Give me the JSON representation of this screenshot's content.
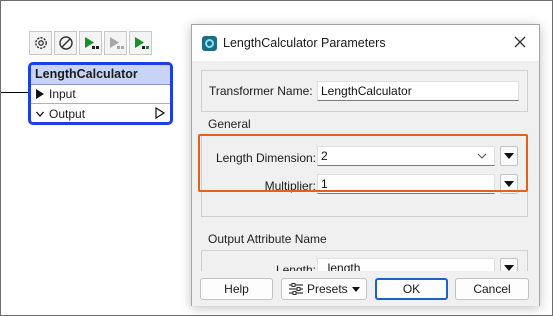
{
  "canvas": {
    "toolbar": {
      "icons": [
        "gear-icon",
        "disable-icon",
        "run-to-this-icon",
        "run-from-this-icon",
        "run-only-this-icon"
      ]
    },
    "node": {
      "title": "LengthCalculator",
      "input_port": "Input",
      "output_port": "Output",
      "selected_color": "#1e3ee8"
    }
  },
  "dialog": {
    "title": "LengthCalculator Parameters",
    "transformer_name_label": "Transformer Name:",
    "transformer_name_value": "LengthCalculator",
    "general": {
      "label": "General",
      "length_dimension_label": "Length Dimension:",
      "length_dimension_value": "2",
      "multiplier_label": "Multiplier:",
      "multiplier_value": "1",
      "highlight_color": "#e2611f"
    },
    "output": {
      "label": "Output Attribute Name",
      "length_label": "Length:",
      "length_value": "_length"
    },
    "buttons": {
      "help": "Help",
      "presets": "Presets",
      "ok": "OK",
      "cancel": "Cancel"
    }
  }
}
